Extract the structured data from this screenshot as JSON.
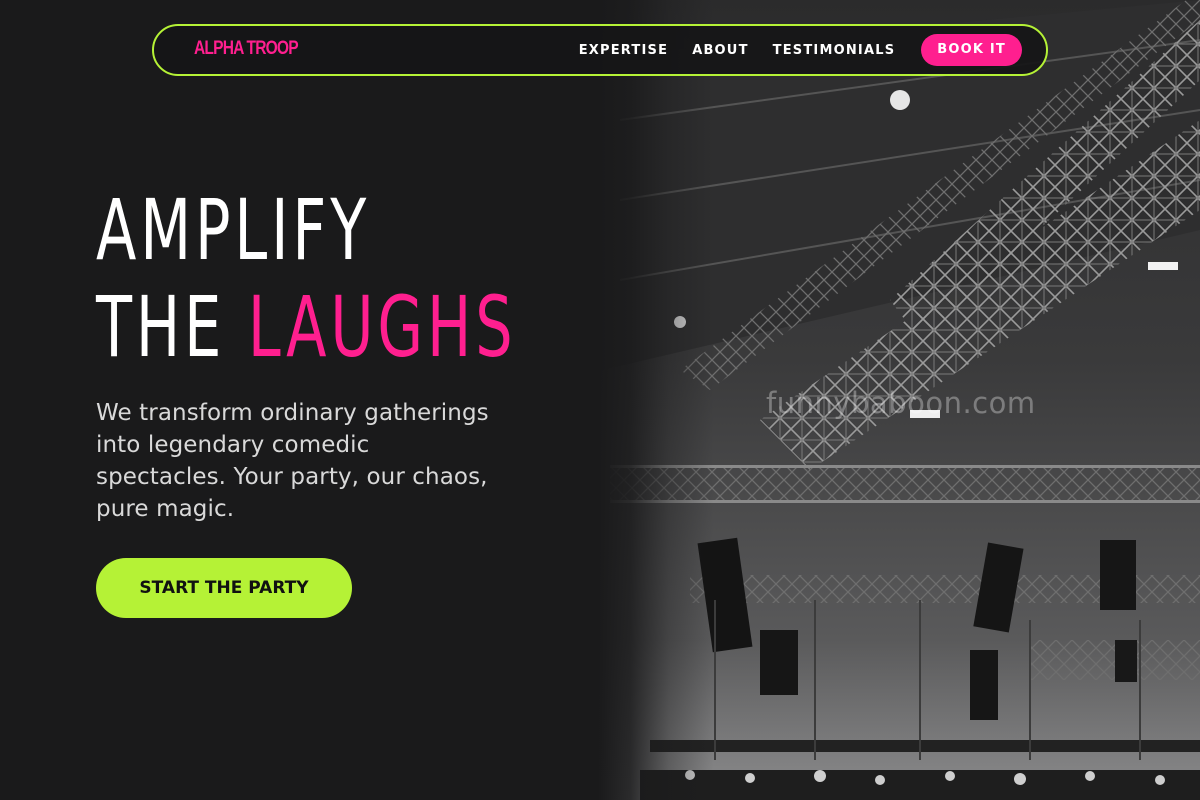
{
  "brand": {
    "logo_text": "ALPHA TROOP"
  },
  "nav": {
    "links": [
      "EXPERTISE",
      "ABOUT",
      "TESTIMONIALS"
    ],
    "book_label": "BOOK IT"
  },
  "hero": {
    "title_line1": "AMPLIFY",
    "title_line2_plain": "THE ",
    "title_line2_accent": "LAUGHS",
    "description": "We transform ordinary gatherings into legendary comedic spectacles. Your party, our chaos, pure magic.",
    "cta_label": "START THE PARTY"
  },
  "watermark": {
    "text": "funnybaboon.com"
  },
  "colors": {
    "background": "#1a1a1b",
    "accent_pink": "#ff1f8f",
    "accent_lime": "#b5f236",
    "text_primary": "#ffffff",
    "text_muted": "#d9d9d9"
  },
  "icons": {
    "stage_image": "concert-stage-truss-photo"
  }
}
